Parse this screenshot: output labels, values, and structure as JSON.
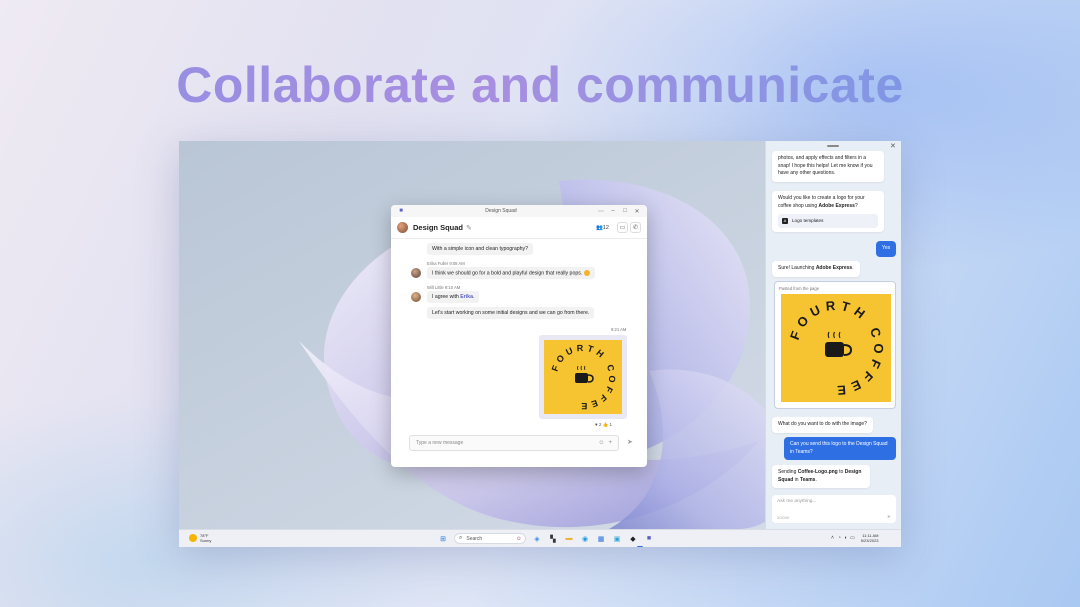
{
  "headline": "Collaborate and communicate",
  "teams": {
    "window_title": "Design Squad",
    "chat_name": "Design Squad",
    "participants": "12",
    "messages": [
      {
        "text": "With a simple icon and clean typography?"
      },
      {
        "author_meta": "Erika Fuller   9:08 AM",
        "text": "I think we should go for a bold and playful design that really pops."
      },
      {
        "author_meta": "Will Little   9:10 AM",
        "text_prefix": "I agree with ",
        "mention": "Erika",
        "text_suffix": "."
      },
      {
        "text": "Let's start working on some initial designs and we can go from there."
      }
    ],
    "image_time": "9:21 AM",
    "logo_text": "FOURTH COFFEE",
    "reactions": "♥ 2    👍 1",
    "compose_placeholder": "Type a new message"
  },
  "copilot": {
    "msg1": "photos, and apply effects and filters in a snap! I hope this helps! Let me know if you have any other questions.",
    "msg2": "Would you like to create a logo for your coffee shop using ",
    "msg2_bold": "Adobe Express",
    "msg2_end": "?",
    "chip": "Logo templates",
    "user_yes": "Yes",
    "msg3_a": "Sure! Launching ",
    "msg3_bold": "Adobe Express",
    "msg3_end": ".",
    "pasted_label": "Pasted from the page",
    "msg4": "What do you want to do with the image?",
    "user_request": "Can you send this logo to the Design Squad in Teams?",
    "msg5_a": "Sending ",
    "msg5_file": "Coffee-Logo.png",
    "msg5_b": " to ",
    "msg5_dest": "Design Squad",
    "msg5_c": " in ",
    "msg5_app": "Teams",
    "msg5_end": ".",
    "input_placeholder": "Ask me anything...",
    "char_count": "0/2000"
  },
  "taskbar": {
    "weather_temp": "78°F",
    "weather_desc": "Sunny",
    "search_label": "Search",
    "time": "11:11 AM",
    "date": "5/23/2023"
  },
  "colors": {
    "accent": "#2f6fe4",
    "logo_yellow": "#f6c431",
    "teams_purple": "#5b5fc7"
  }
}
